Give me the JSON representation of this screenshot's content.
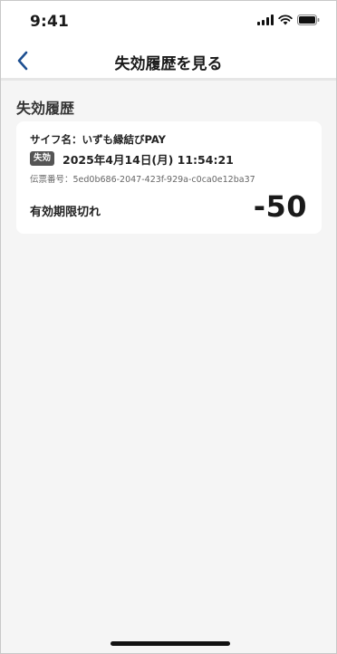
{
  "status_bar": {
    "time": "9:41",
    "icons": [
      "signal-icon",
      "wifi-icon",
      "battery-icon"
    ]
  },
  "nav": {
    "back_icon": "chevron-left-icon",
    "title": "失効履歴を見る",
    "accent_color": "#1d4f91"
  },
  "section": {
    "title": "失効履歴"
  },
  "history": [
    {
      "wallet_name": "サイフ名：いずも縁結びPAY",
      "badge": "失効",
      "datetime": "2025年4月14日(月) 11:54:21",
      "slip_number": "伝票番号：5ed0b686-2047-423f-929a-c0ca0e12ba37",
      "reason": "有効期限切れ",
      "amount": "-50"
    }
  ]
}
